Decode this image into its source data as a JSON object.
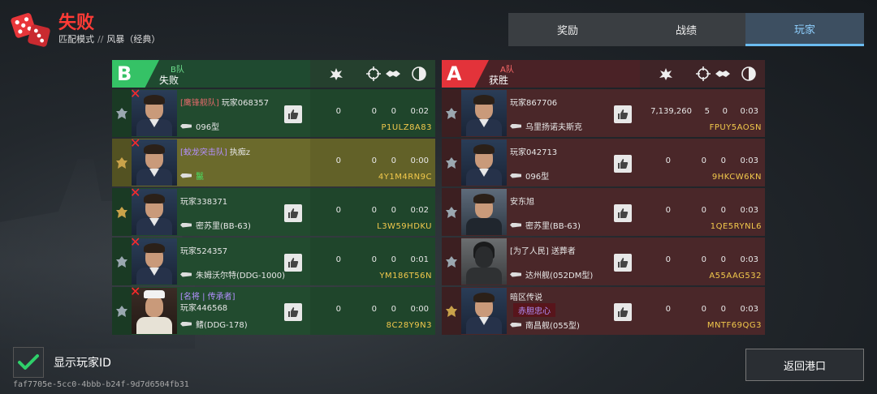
{
  "header": {
    "result": "失败",
    "mode": "匹配模式",
    "separator": "//",
    "map": "风暴（经典）"
  },
  "tabs": [
    {
      "label": "奖励",
      "active": false
    },
    {
      "label": "战绩",
      "active": false
    },
    {
      "label": "玩家",
      "active": true
    }
  ],
  "team_b": {
    "letter": "B",
    "name": "B队",
    "result": "失败",
    "players": [
      {
        "clan": "[鹰锋舰队]",
        "name": "玩家068357",
        "ship": "096型",
        "stat1": "0",
        "stat2": "0",
        "stat3": "0",
        "stat4": "0:02",
        "code": "P1ULZ8A83",
        "dead": true
      },
      {
        "clan": "[蛟龙突击队]",
        "name": "执痴z",
        "ship": "鬣",
        "stat1": "0",
        "stat2": "0",
        "stat3": "0",
        "stat4": "0:00",
        "code": "4Y1M4RN9C",
        "dead": true
      },
      {
        "clan": "",
        "name": "玩家338371",
        "ship": "密苏里(BB-63)",
        "stat1": "0",
        "stat2": "0",
        "stat3": "0",
        "stat4": "0:02",
        "code": "L3W59HDKU",
        "dead": true
      },
      {
        "clan": "",
        "name": "玩家524357",
        "ship": "朱姆沃尔特(DDG-1000)",
        "stat1": "0",
        "stat2": "0",
        "stat3": "0",
        "stat4": "0:01",
        "code": "YM186T56N",
        "dead": true
      },
      {
        "clan": "[名将 | 传承者]",
        "name": "玩家446568",
        "ship": "鳍(DDG-178)",
        "stat1": "0",
        "stat2": "0",
        "stat3": "0",
        "stat4": "0:00",
        "code": "8C28Y9N3",
        "dead": true
      }
    ]
  },
  "team_a": {
    "letter": "A",
    "name": "A队",
    "result": "获胜",
    "players": [
      {
        "clan": "",
        "name": "玩家867706",
        "badge": "",
        "ship": "乌里扬诺夫斯克",
        "stat1": "7,139,260",
        "stat2": "5",
        "stat3": "0",
        "stat4": "0:03",
        "code": "FPUY5AOSN"
      },
      {
        "clan": "",
        "name": "玩家042713",
        "badge": "",
        "ship": "096型",
        "stat1": "0",
        "stat2": "0",
        "stat3": "0",
        "stat4": "0:03",
        "code": "9HKCW6KN"
      },
      {
        "clan": "",
        "name": "安东旭",
        "badge": "",
        "ship": "密苏里(BB-63)",
        "stat1": "0",
        "stat2": "0",
        "stat3": "0",
        "stat4": "0:03",
        "code": "1QE5RYNL6"
      },
      {
        "clan": "[为了人民]",
        "name": "送葬者",
        "badge": "",
        "ship": "达州舰(052DM型)",
        "stat1": "0",
        "stat2": "0",
        "stat3": "0",
        "stat4": "0:03",
        "code": "A55AAG532"
      },
      {
        "clan": "",
        "name": "暗区传说",
        "badge": "赤胆忠心",
        "ship": "南昌舰(055型)",
        "stat1": "0",
        "stat2": "0",
        "stat3": "0",
        "stat4": "0:03",
        "code": "MNTF69QG3"
      }
    ]
  },
  "bottom": {
    "show_id_label": "显示玩家ID",
    "show_id_checked": true,
    "session_id": "faf7705e-5cc0-4bbb-b24f-9d7d6504fb31",
    "return_label": "返回港口"
  },
  "colors": {
    "defeat_red": "#ff3b36",
    "team_b_green": "#35c266",
    "team_a_red": "#e3333a",
    "code_yellow": "#f2c94c",
    "active_tab_blue": "#6bbcf0"
  }
}
